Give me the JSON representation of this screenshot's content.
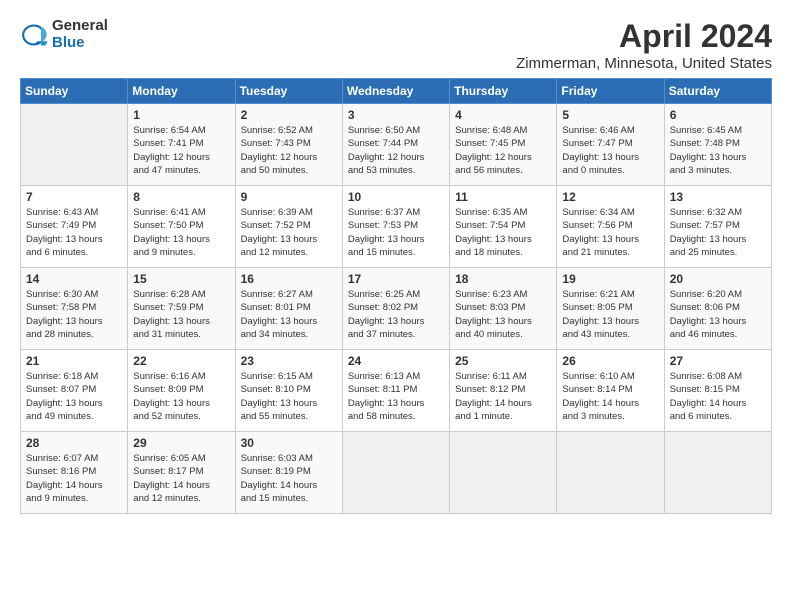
{
  "logo": {
    "general": "General",
    "blue": "Blue"
  },
  "title": "April 2024",
  "subtitle": "Zimmerman, Minnesota, United States",
  "days_of_week": [
    "Sunday",
    "Monday",
    "Tuesday",
    "Wednesday",
    "Thursday",
    "Friday",
    "Saturday"
  ],
  "weeks": [
    [
      {
        "day": "",
        "sunrise": "",
        "sunset": "",
        "daylight": ""
      },
      {
        "day": "1",
        "sunrise": "Sunrise: 6:54 AM",
        "sunset": "Sunset: 7:41 PM",
        "daylight": "Daylight: 12 hours and 47 minutes."
      },
      {
        "day": "2",
        "sunrise": "Sunrise: 6:52 AM",
        "sunset": "Sunset: 7:43 PM",
        "daylight": "Daylight: 12 hours and 50 minutes."
      },
      {
        "day": "3",
        "sunrise": "Sunrise: 6:50 AM",
        "sunset": "Sunset: 7:44 PM",
        "daylight": "Daylight: 12 hours and 53 minutes."
      },
      {
        "day": "4",
        "sunrise": "Sunrise: 6:48 AM",
        "sunset": "Sunset: 7:45 PM",
        "daylight": "Daylight: 12 hours and 56 minutes."
      },
      {
        "day": "5",
        "sunrise": "Sunrise: 6:46 AM",
        "sunset": "Sunset: 7:47 PM",
        "daylight": "Daylight: 13 hours and 0 minutes."
      },
      {
        "day": "6",
        "sunrise": "Sunrise: 6:45 AM",
        "sunset": "Sunset: 7:48 PM",
        "daylight": "Daylight: 13 hours and 3 minutes."
      }
    ],
    [
      {
        "day": "7",
        "sunrise": "Sunrise: 6:43 AM",
        "sunset": "Sunset: 7:49 PM",
        "daylight": "Daylight: 13 hours and 6 minutes."
      },
      {
        "day": "8",
        "sunrise": "Sunrise: 6:41 AM",
        "sunset": "Sunset: 7:50 PM",
        "daylight": "Daylight: 13 hours and 9 minutes."
      },
      {
        "day": "9",
        "sunrise": "Sunrise: 6:39 AM",
        "sunset": "Sunset: 7:52 PM",
        "daylight": "Daylight: 13 hours and 12 minutes."
      },
      {
        "day": "10",
        "sunrise": "Sunrise: 6:37 AM",
        "sunset": "Sunset: 7:53 PM",
        "daylight": "Daylight: 13 hours and 15 minutes."
      },
      {
        "day": "11",
        "sunrise": "Sunrise: 6:35 AM",
        "sunset": "Sunset: 7:54 PM",
        "daylight": "Daylight: 13 hours and 18 minutes."
      },
      {
        "day": "12",
        "sunrise": "Sunrise: 6:34 AM",
        "sunset": "Sunset: 7:56 PM",
        "daylight": "Daylight: 13 hours and 21 minutes."
      },
      {
        "day": "13",
        "sunrise": "Sunrise: 6:32 AM",
        "sunset": "Sunset: 7:57 PM",
        "daylight": "Daylight: 13 hours and 25 minutes."
      }
    ],
    [
      {
        "day": "14",
        "sunrise": "Sunrise: 6:30 AM",
        "sunset": "Sunset: 7:58 PM",
        "daylight": "Daylight: 13 hours and 28 minutes."
      },
      {
        "day": "15",
        "sunrise": "Sunrise: 6:28 AM",
        "sunset": "Sunset: 7:59 PM",
        "daylight": "Daylight: 13 hours and 31 minutes."
      },
      {
        "day": "16",
        "sunrise": "Sunrise: 6:27 AM",
        "sunset": "Sunset: 8:01 PM",
        "daylight": "Daylight: 13 hours and 34 minutes."
      },
      {
        "day": "17",
        "sunrise": "Sunrise: 6:25 AM",
        "sunset": "Sunset: 8:02 PM",
        "daylight": "Daylight: 13 hours and 37 minutes."
      },
      {
        "day": "18",
        "sunrise": "Sunrise: 6:23 AM",
        "sunset": "Sunset: 8:03 PM",
        "daylight": "Daylight: 13 hours and 40 minutes."
      },
      {
        "day": "19",
        "sunrise": "Sunrise: 6:21 AM",
        "sunset": "Sunset: 8:05 PM",
        "daylight": "Daylight: 13 hours and 43 minutes."
      },
      {
        "day": "20",
        "sunrise": "Sunrise: 6:20 AM",
        "sunset": "Sunset: 8:06 PM",
        "daylight": "Daylight: 13 hours and 46 minutes."
      }
    ],
    [
      {
        "day": "21",
        "sunrise": "Sunrise: 6:18 AM",
        "sunset": "Sunset: 8:07 PM",
        "daylight": "Daylight: 13 hours and 49 minutes."
      },
      {
        "day": "22",
        "sunrise": "Sunrise: 6:16 AM",
        "sunset": "Sunset: 8:09 PM",
        "daylight": "Daylight: 13 hours and 52 minutes."
      },
      {
        "day": "23",
        "sunrise": "Sunrise: 6:15 AM",
        "sunset": "Sunset: 8:10 PM",
        "daylight": "Daylight: 13 hours and 55 minutes."
      },
      {
        "day": "24",
        "sunrise": "Sunrise: 6:13 AM",
        "sunset": "Sunset: 8:11 PM",
        "daylight": "Daylight: 13 hours and 58 minutes."
      },
      {
        "day": "25",
        "sunrise": "Sunrise: 6:11 AM",
        "sunset": "Sunset: 8:12 PM",
        "daylight": "Daylight: 14 hours and 1 minute."
      },
      {
        "day": "26",
        "sunrise": "Sunrise: 6:10 AM",
        "sunset": "Sunset: 8:14 PM",
        "daylight": "Daylight: 14 hours and 3 minutes."
      },
      {
        "day": "27",
        "sunrise": "Sunrise: 6:08 AM",
        "sunset": "Sunset: 8:15 PM",
        "daylight": "Daylight: 14 hours and 6 minutes."
      }
    ],
    [
      {
        "day": "28",
        "sunrise": "Sunrise: 6:07 AM",
        "sunset": "Sunset: 8:16 PM",
        "daylight": "Daylight: 14 hours and 9 minutes."
      },
      {
        "day": "29",
        "sunrise": "Sunrise: 6:05 AM",
        "sunset": "Sunset: 8:17 PM",
        "daylight": "Daylight: 14 hours and 12 minutes."
      },
      {
        "day": "30",
        "sunrise": "Sunrise: 6:03 AM",
        "sunset": "Sunset: 8:19 PM",
        "daylight": "Daylight: 14 hours and 15 minutes."
      },
      {
        "day": "",
        "sunrise": "",
        "sunset": "",
        "daylight": ""
      },
      {
        "day": "",
        "sunrise": "",
        "sunset": "",
        "daylight": ""
      },
      {
        "day": "",
        "sunrise": "",
        "sunset": "",
        "daylight": ""
      },
      {
        "day": "",
        "sunrise": "",
        "sunset": "",
        "daylight": ""
      }
    ]
  ]
}
